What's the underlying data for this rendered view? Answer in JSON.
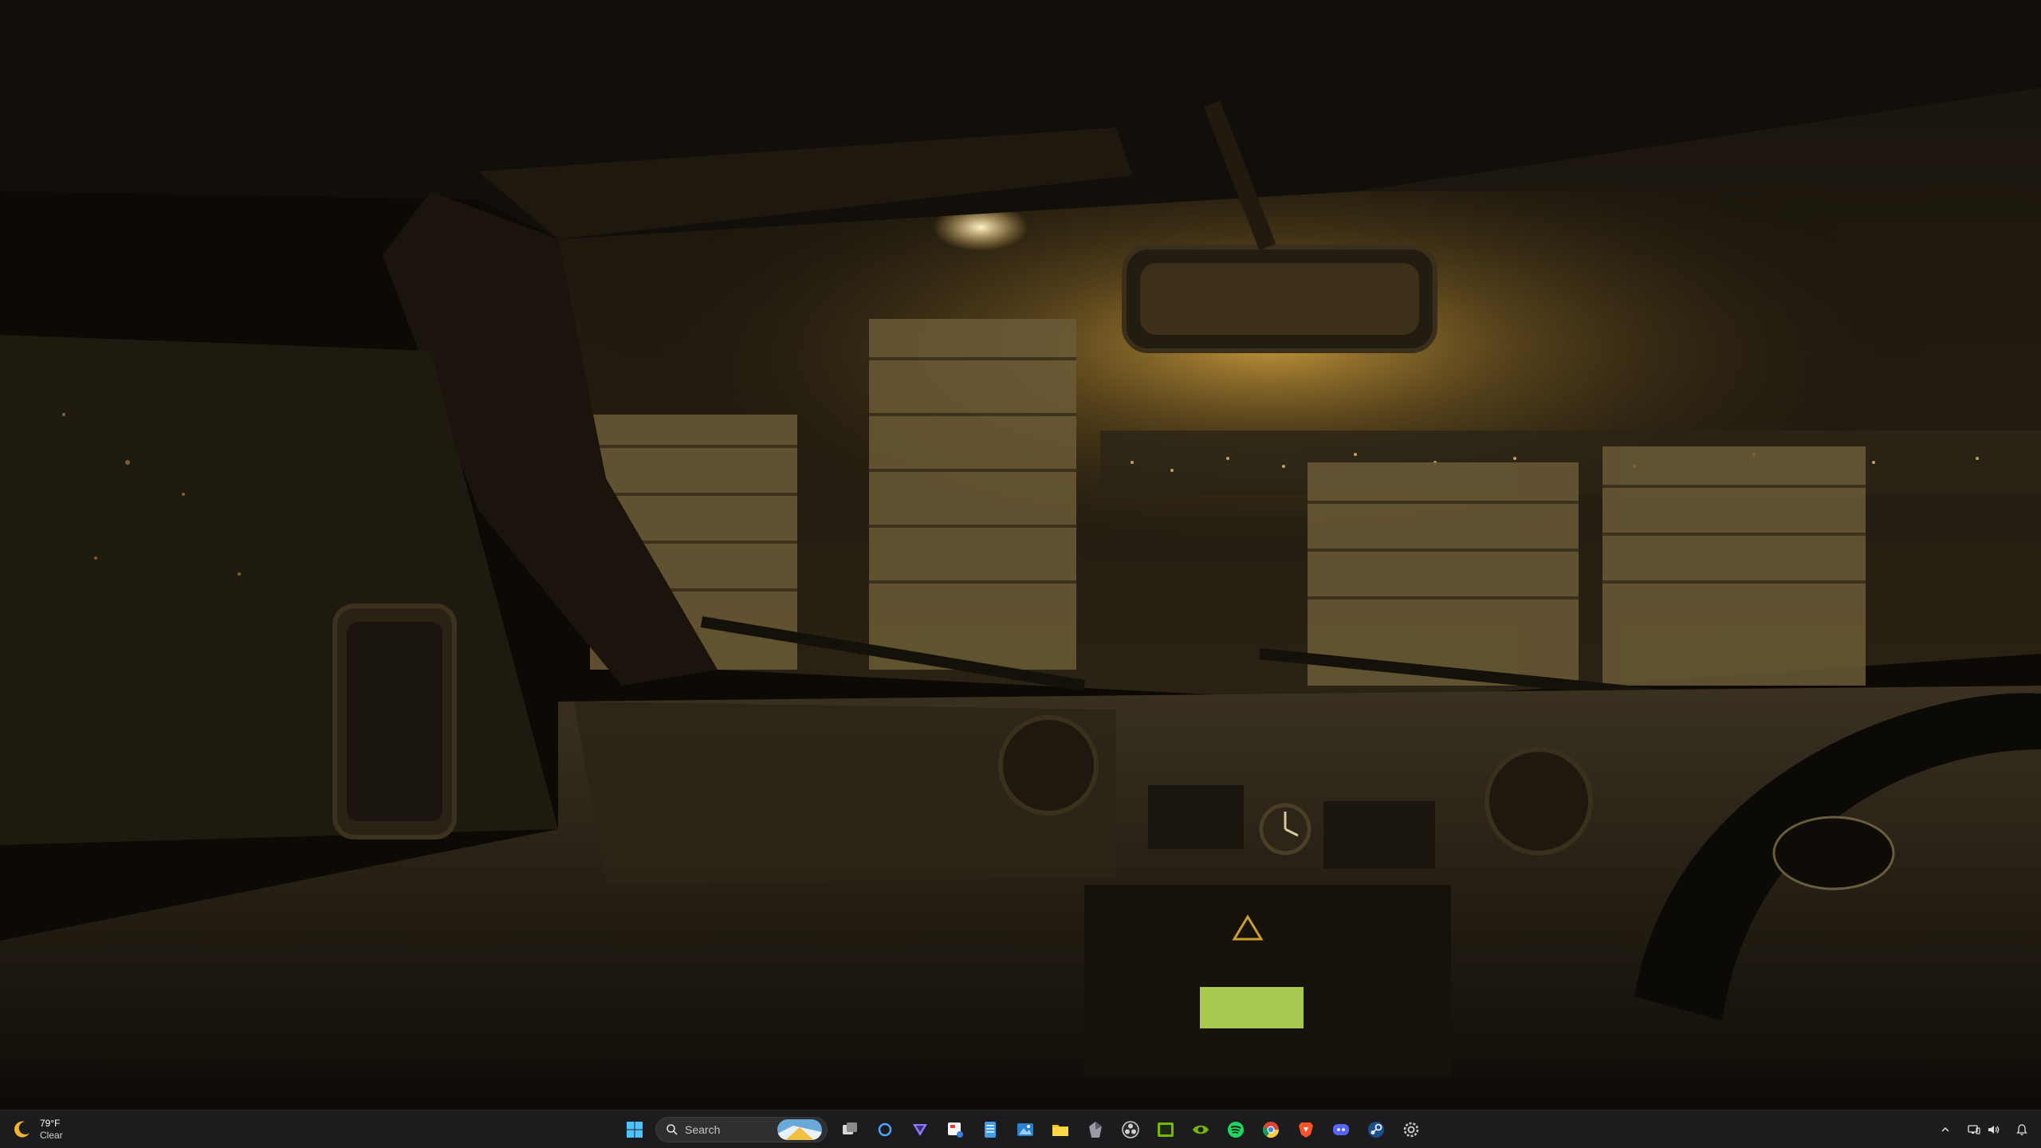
{
  "wallpaper": {
    "description_icon": "car-interior-rainy-night-scene"
  },
  "taskbar": {
    "weather": {
      "icon": "moon-icon",
      "temperature": "79°F",
      "condition": "Clear"
    },
    "start_icon": "windows-start-icon",
    "search": {
      "label": "Search",
      "icon": "search-icon"
    },
    "pinned_apps": [
      {
        "name": "task-view-icon"
      },
      {
        "name": "cortana-icon"
      },
      {
        "name": "proton-vpn-icon"
      },
      {
        "name": "snipping-tool-icon"
      },
      {
        "name": "notepad-icon"
      },
      {
        "name": "photos-icon"
      },
      {
        "name": "file-explorer-icon"
      },
      {
        "name": "obsidian-icon"
      },
      {
        "name": "obs-studio-icon"
      },
      {
        "name": "nvidia-app-icon"
      },
      {
        "name": "nvidia-geforce-icon"
      },
      {
        "name": "spotify-icon"
      },
      {
        "name": "chrome-icon"
      },
      {
        "name": "brave-icon"
      },
      {
        "name": "discord-icon"
      },
      {
        "name": "steam-icon"
      },
      {
        "name": "settings-icon"
      }
    ],
    "tray": {
      "overflow_icon": "chevron-up-icon",
      "network_icon": "network-icon",
      "volume_icon": "volume-icon",
      "notification_icon": "notification-bell-icon"
    }
  },
  "colors": {
    "taskbar_bg": "#1c1c1e",
    "accent": "#0078d4"
  }
}
